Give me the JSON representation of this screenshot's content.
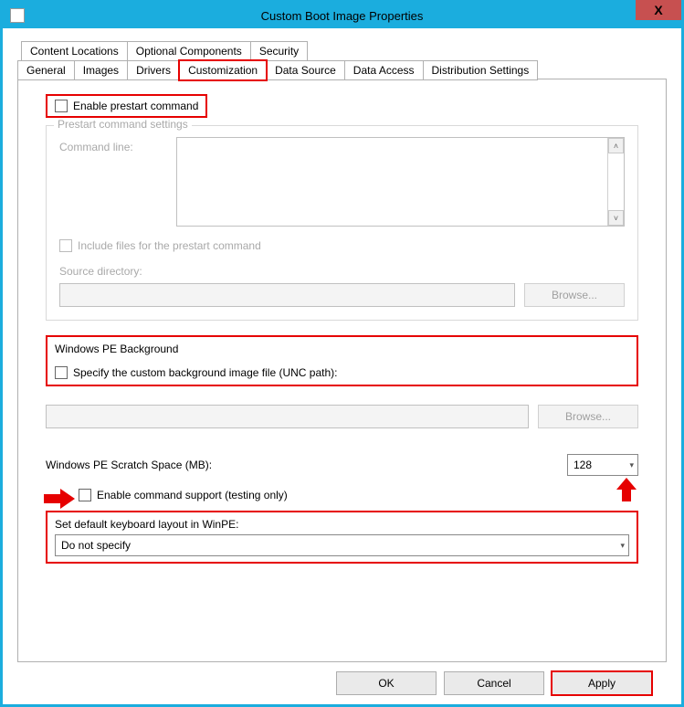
{
  "window": {
    "title": "Custom Boot Image Properties"
  },
  "controls": {
    "close_glyph": "X"
  },
  "tabs": {
    "row1": [
      "Content Locations",
      "Optional Components",
      "Security"
    ],
    "row2": [
      "General",
      "Images",
      "Drivers",
      "Customization",
      "Data Source",
      "Data Access",
      "Distribution Settings"
    ],
    "active": "Customization"
  },
  "custom": {
    "enable_prestart_label": "Enable prestart command",
    "prestart_group_title": "Prestart command settings",
    "command_line_label": "Command line:",
    "include_files_label": "Include files for the prestart command",
    "source_dir_label": "Source directory:",
    "browse1_label": "Browse...",
    "winpe_bg_group_title": "Windows PE Background",
    "specify_bg_label": "Specify the custom background image file (UNC path):",
    "browse2_label": "Browse...",
    "scratch_label": "Windows PE Scratch Space (MB):",
    "scratch_value": "128",
    "enable_cmd_support_label": "Enable command support (testing only)",
    "keyboard_layout_label": "Set default keyboard layout in WinPE:",
    "keyboard_layout_value": "Do not specify"
  },
  "buttons": {
    "ok": "OK",
    "cancel": "Cancel",
    "apply": "Apply"
  }
}
